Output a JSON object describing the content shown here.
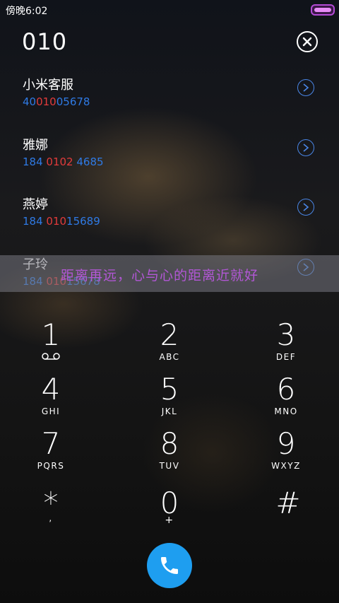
{
  "status_bar": {
    "time": "傍晚6:02"
  },
  "dialer": {
    "number": "010"
  },
  "contacts": [
    {
      "name": "小米客服",
      "number_pre": "40",
      "number_match": "010",
      "number_post": "05678"
    },
    {
      "name": "雅娜",
      "number_pre": "184 ",
      "number_match": "0102",
      "number_post": " 4685"
    },
    {
      "name": "燕婷",
      "number_pre": "184 ",
      "number_match": "010",
      "number_post": "15689"
    },
    {
      "name": "子玲",
      "number_pre": "184 ",
      "number_match": "010",
      "number_post": "15678"
    }
  ],
  "banner": {
    "text": "距离再远，心与心的距离近就好"
  },
  "keypad": [
    {
      "digit": "1",
      "letters": ""
    },
    {
      "digit": "2",
      "letters": "ABC"
    },
    {
      "digit": "3",
      "letters": "DEF"
    },
    {
      "digit": "4",
      "letters": "GHI"
    },
    {
      "digit": "5",
      "letters": "JKL"
    },
    {
      "digit": "6",
      "letters": "MNO"
    },
    {
      "digit": "7",
      "letters": "PQRS"
    },
    {
      "digit": "8",
      "letters": "TUV"
    },
    {
      "digit": "9",
      "letters": "WXYZ"
    },
    {
      "digit": "*",
      "letters": ","
    },
    {
      "digit": "0",
      "letters": "+"
    },
    {
      "digit": "#",
      "letters": ""
    }
  ],
  "colors": {
    "accent": "#1e9ef0",
    "match_highlight": "#e23b3b",
    "number_text": "#2f7ae5",
    "banner_text": "#b257d6"
  },
  "icons": {
    "clear": "close-circle-icon",
    "contact_detail": "chevron-right-circle-icon",
    "call": "phone-icon",
    "voicemail": "voicemail-icon"
  }
}
